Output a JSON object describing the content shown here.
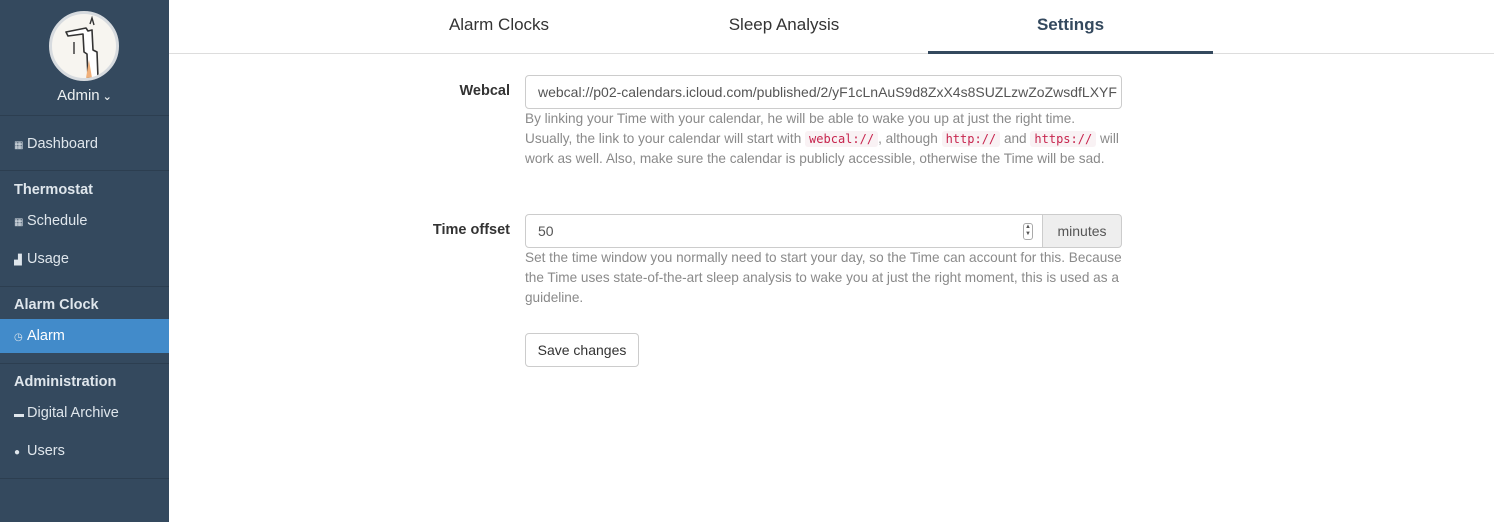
{
  "sidebar": {
    "user_label": "Admin",
    "dashboard": "Dashboard",
    "sections": {
      "thermostat": "Thermostat",
      "alarm_clock": "Alarm Clock",
      "administration": "Administration"
    },
    "items": {
      "schedule": "Schedule",
      "usage": "Usage",
      "alarm": "Alarm",
      "digital_archive": "Digital Archive",
      "users": "Users"
    },
    "active_item": "Alarm",
    "colors": {
      "background": "#34495e",
      "active": "#428bca"
    }
  },
  "tabs": [
    {
      "label": "Alarm Clocks"
    },
    {
      "label": "Sleep Analysis"
    },
    {
      "label": "Settings",
      "active": true
    }
  ],
  "form": {
    "webcal": {
      "label": "Webcal",
      "value": "webcal://p02-calendars.icloud.com/published/2/yF1cLnAuS9d8ZxX4s8SUZLzwZoZwsdfLXYF",
      "help_1": "By linking your Time with your calendar, he will be able to wake you up at just the right time. Usually, the link to your calendar will start with",
      "code_webcal": "webcal://",
      "help_2": ", although",
      "code_http": "http://",
      "help_3": "and",
      "code_https": "https://",
      "help_4": "will work as well. Also, make sure the calendar is publicly accessible, otherwise the Time will be sad."
    },
    "time_offset": {
      "label": "Time offset",
      "value": "50",
      "unit": "minutes",
      "help": "Set the time window you normally need to start your day, so the Time can account for this. Because the Time uses state-of-the-art sleep analysis to wake you at just the right moment, this is used as a guideline."
    },
    "save_label": "Save changes"
  }
}
